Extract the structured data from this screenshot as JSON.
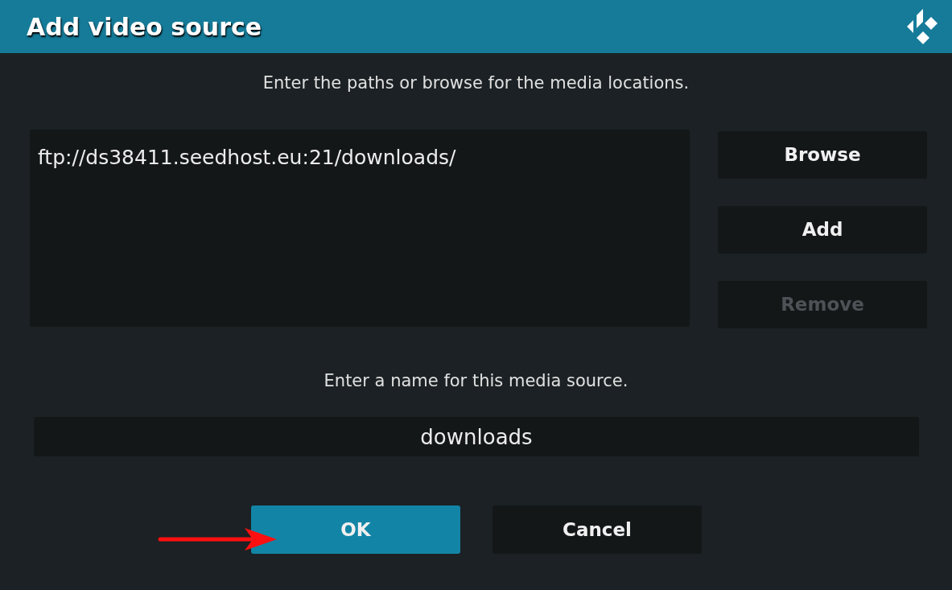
{
  "window": {
    "title": "Add video source"
  },
  "paths_prompt": "Enter the paths or browse for the media locations.",
  "paths": [
    {
      "text": "ftp://ds38411.seedhost.eu:21/downloads/"
    }
  ],
  "side_buttons": [
    {
      "label": "Browse",
      "disabled": false
    },
    {
      "label": "Add",
      "disabled": false
    },
    {
      "label": "Remove",
      "disabled": true
    }
  ],
  "name_prompt": "Enter a name for this media source.",
  "name_field": {
    "value": "downloads"
  },
  "dialog_buttons": [
    {
      "label": "OK",
      "focused": true
    },
    {
      "label": "Cancel",
      "focused": false
    }
  ],
  "annotation": {
    "kind": "arrow"
  }
}
